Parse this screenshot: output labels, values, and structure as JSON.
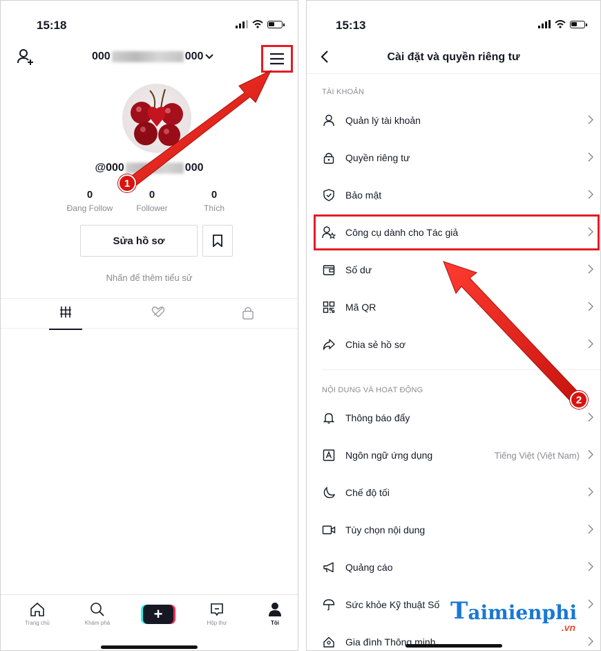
{
  "left": {
    "status_time": "15:18",
    "username_prefix": "000",
    "username_suffix": "000",
    "handle_prefix": "@000",
    "handle_suffix": "000",
    "stats": [
      {
        "value": "0",
        "label": "Đang Follow"
      },
      {
        "value": "0",
        "label": "Follower"
      },
      {
        "value": "0",
        "label": "Thích"
      }
    ],
    "edit_profile_label": "Sửa hồ sơ",
    "bio_placeholder": "Nhấn để thêm tiểu sử",
    "nav": [
      {
        "label": "Trang chủ"
      },
      {
        "label": "Khám phá"
      },
      {
        "label": "+"
      },
      {
        "label": "Hộp thư"
      },
      {
        "label": "Tôi"
      }
    ],
    "badge": "1"
  },
  "right": {
    "status_time": "15:13",
    "title": "Cài đặt và quyền riêng tư",
    "section_account": "TÀI KHOẢN",
    "account_items": [
      {
        "label": "Quản lý tài khoản",
        "icon": "user-icon"
      },
      {
        "label": "Quyền riêng tư",
        "icon": "lock-icon"
      },
      {
        "label": "Bảo mật",
        "icon": "shield-icon"
      },
      {
        "label": "Công cụ dành cho Tác giả",
        "icon": "creator-tools-icon"
      },
      {
        "label": "Số dư",
        "icon": "wallet-icon"
      },
      {
        "label": "Mã QR",
        "icon": "qr-icon"
      },
      {
        "label": "Chia sẻ hồ sơ",
        "icon": "share-icon"
      }
    ],
    "section_content": "NỘI DUNG VÀ HOẠT ĐỘNG",
    "content_items": [
      {
        "label": "Thông báo đẩy",
        "icon": "bell-icon",
        "value": ""
      },
      {
        "label": "Ngôn ngữ ứng dụng",
        "icon": "language-icon",
        "value": "Tiếng Việt (Việt Nam)"
      },
      {
        "label": "Chế độ tối",
        "icon": "moon-icon",
        "value": ""
      },
      {
        "label": "Tùy chọn nội dung",
        "icon": "video-icon",
        "value": ""
      },
      {
        "label": "Quảng cáo",
        "icon": "megaphone-icon",
        "value": ""
      },
      {
        "label": "Sức khỏe Kỹ thuật Số",
        "icon": "umbrella-icon",
        "value": ""
      },
      {
        "label": "Gia đình Thông minh",
        "icon": "family-icon",
        "value": ""
      }
    ],
    "badge": "2"
  },
  "watermark": {
    "t": "T",
    "word": "aimienphi",
    "tld": ".vn"
  },
  "colors": {
    "highlight": "#e31b23",
    "arrow": "#e31b23",
    "watermark": "#1878d6"
  }
}
